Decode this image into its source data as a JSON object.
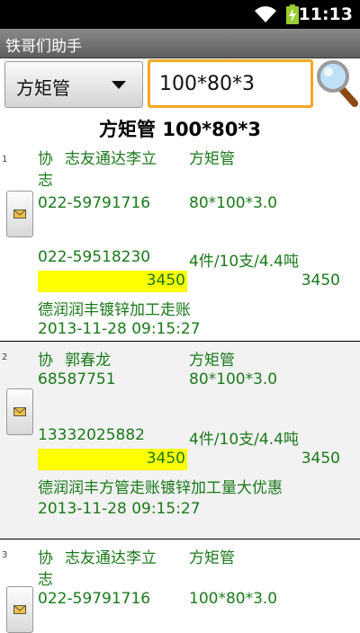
{
  "status": {
    "time": "11:13",
    "icons": [
      "wifi-icon",
      "battery-charging-icon"
    ]
  },
  "app": {
    "title": "铁哥们助手"
  },
  "search": {
    "category": "方矩管",
    "query": "100*80*3",
    "icon": "magnifier-icon"
  },
  "heading": "方矩管 100*80*3",
  "results": [
    {
      "index": "1",
      "tag": "协",
      "company_line1": "志友通达李立",
      "company_line2": "志",
      "product": "方矩管",
      "phone1": "022-59791716",
      "spec": "80*100*3.0",
      "phone2": "022-59518230",
      "quantity": "4件/10支/4.4吨",
      "price_highlight": "3450",
      "price": "3450",
      "note": "德润润丰镀锌加工走账",
      "datetime": "2013-11-28  09:15:27"
    },
    {
      "index": "2",
      "tag": "协",
      "company_line1": "郭春龙",
      "company_line2": "",
      "product": "方矩管",
      "phone1": "68587751",
      "spec": "80*100*3.0",
      "phone2": "13332025882",
      "quantity": "4件/10支/4.4吨",
      "price_highlight": "3450",
      "price": "3450",
      "note": "德润润丰方管走账镀锌加工量大优惠",
      "datetime": "2013-11-28  09:15:27"
    },
    {
      "index": "3",
      "tag": "协",
      "company_line1": "志友通达李立",
      "company_line2": "志",
      "product": "方矩管",
      "phone1": "022-59791716",
      "spec": "100*80*3.0"
    }
  ]
}
